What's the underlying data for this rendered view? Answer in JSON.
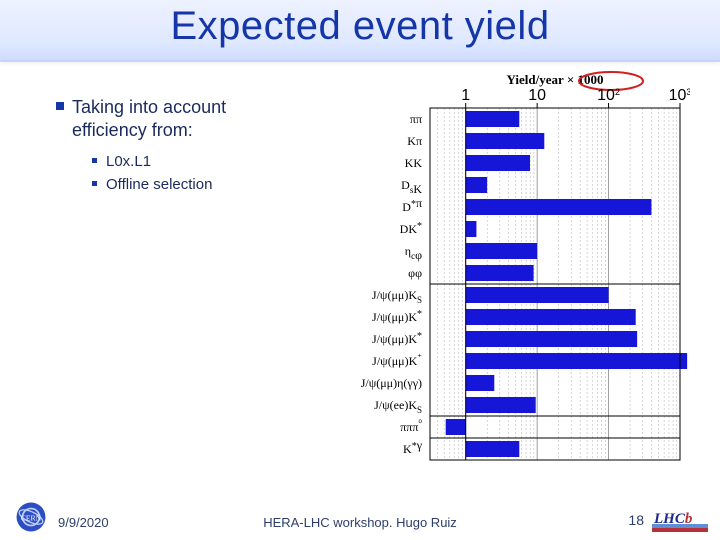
{
  "title": "Expected event yield",
  "bullets": {
    "main": "Taking into account efficiency from:",
    "sub": [
      "L0x.L1",
      "Offline selection"
    ]
  },
  "footer": {
    "date": "9/9/2020",
    "venue": "HERA-LHC workshop. Hugo Ruiz",
    "page": "18"
  },
  "logos": {
    "cern_name": "cern-logo",
    "lhcb_text": "LHCb"
  },
  "chart_data": {
    "type": "bar",
    "orientation": "horizontal",
    "title": "Yield/year × 1000",
    "title_highlight": "× 1000",
    "x_axis": {
      "position": "top",
      "scale": "log10",
      "ticks": [
        1,
        10,
        100,
        1000
      ],
      "tick_labels": [
        "1",
        "10",
        "10^2",
        "10^3"
      ]
    },
    "group_separators_after": [
      7,
      13,
      14
    ],
    "categories": [
      "ππ",
      "Kπ",
      "KK",
      "D_sK",
      "D*π",
      "DK*",
      "η_cφ",
      "φφ",
      "J/ψ(μμ)K_S",
      "J/ψ(μμ)K*",
      "J/ψ(μμ)K*",
      "J/ψ(μμ)K⁺",
      "J/ψ(μμ)η(γγ)",
      "J/ψ(ee)K_S",
      "πππ⁰",
      "K*γ"
    ],
    "values_log10": [
      0.75,
      1.1,
      0.9,
      0.3,
      2.6,
      0.15,
      1.0,
      0.95,
      2.0,
      2.38,
      2.4,
      3.1,
      0.4,
      0.98,
      -0.28,
      0.75
    ],
    "values": [
      6,
      13,
      8,
      2,
      400,
      1.4,
      10,
      9,
      100,
      240,
      250,
      1250,
      2.5,
      9.5,
      0.52,
      6
    ],
    "annotation": "Red circle around the × 1000 in the axis title."
  }
}
